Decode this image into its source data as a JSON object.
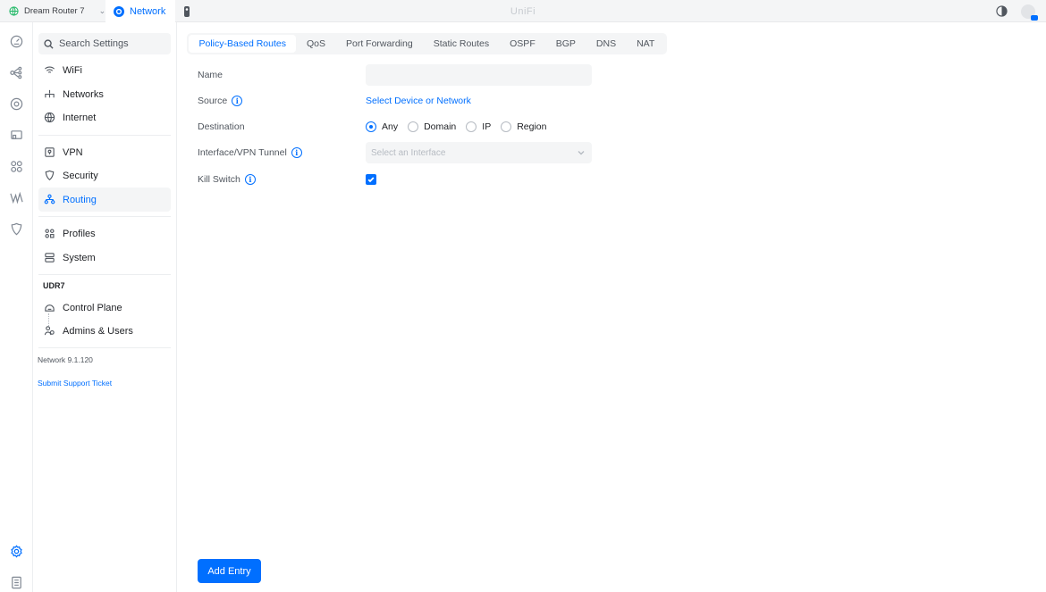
{
  "topbar": {
    "device_name": "Dream Router 7",
    "app_tab": "Network",
    "brand": "UniFi"
  },
  "sidebar": {
    "search_placeholder": "Search Settings",
    "items": [
      {
        "label": "WiFi",
        "icon": "wifi-icon"
      },
      {
        "label": "Networks",
        "icon": "networks-icon"
      },
      {
        "label": "Internet",
        "icon": "globe-icon"
      },
      {
        "label": "VPN",
        "icon": "vpn-icon"
      },
      {
        "label": "Security",
        "icon": "shield-icon"
      },
      {
        "label": "Routing",
        "icon": "routing-icon",
        "active": true
      },
      {
        "label": "Profiles",
        "icon": "profiles-icon"
      },
      {
        "label": "System",
        "icon": "system-icon"
      }
    ],
    "section_label": "UDR7",
    "section_items": [
      {
        "label": "Control Plane",
        "icon": "control-plane-icon"
      },
      {
        "label": "Admins & Users",
        "icon": "users-icon"
      }
    ],
    "version": "Network 9.1.120",
    "support_link": "Submit Support Ticket"
  },
  "tabs": [
    {
      "label": "Policy-Based Routes",
      "active": true
    },
    {
      "label": "QoS"
    },
    {
      "label": "Port Forwarding"
    },
    {
      "label": "Static Routes"
    },
    {
      "label": "OSPF"
    },
    {
      "label": "BGP"
    },
    {
      "label": "DNS"
    },
    {
      "label": "NAT"
    }
  ],
  "form": {
    "name_label": "Name",
    "name_value": "",
    "source_label": "Source",
    "source_link": "Select Device or Network",
    "destination_label": "Destination",
    "destination_options": [
      "Any",
      "Domain",
      "IP",
      "Region"
    ],
    "destination_selected": "Any",
    "interface_label": "Interface/VPN Tunnel",
    "interface_placeholder": "Select an Interface",
    "kill_switch_label": "Kill Switch",
    "kill_switch_checked": true
  },
  "actions": {
    "add_entry": "Add Entry"
  },
  "colors": {
    "accent": "#006fff",
    "surface": "#f4f5f6",
    "text": "#212327",
    "muted": "#50565e"
  }
}
